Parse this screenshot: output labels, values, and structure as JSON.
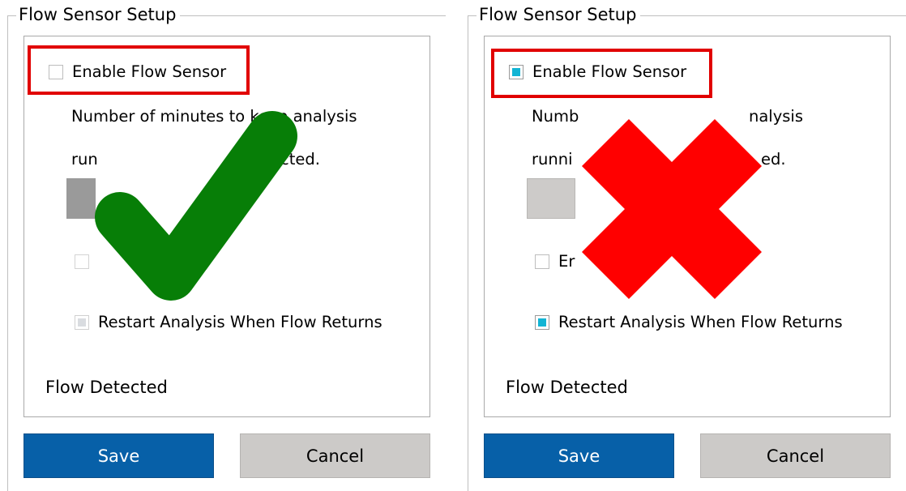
{
  "panels": [
    {
      "group_title": "Flow Sensor Setup",
      "enable_label": "Enable Flow Sensor",
      "enable_checked": false,
      "desc_line1": "Number of minutes to keep analysis",
      "desc_line2_visible_start": "run",
      "desc_line2_visible_end": "cted.",
      "second_checkbox_label_visible": "",
      "restart_label": "Restart Analysis When Flow Returns",
      "restart_checked": false,
      "status_text": "Flow Detected",
      "save_label": "Save",
      "cancel_label": "Cancel",
      "overlay_icon": "checkmark-icon"
    },
    {
      "group_title": "Flow Sensor Setup",
      "enable_label": "Enable Flow Sensor",
      "enable_checked": true,
      "desc_line1_visible_start": "Numb",
      "desc_line1_visible_end": "nalysis",
      "desc_line2_visible_start": "runni",
      "desc_line2_visible_end": "ed.",
      "second_checkbox_label_visible": "Er",
      "restart_label": "Restart Analysis When Flow Returns",
      "restart_checked": true,
      "status_text": "Flow Detected",
      "save_label": "Save",
      "cancel_label": "Cancel",
      "overlay_icon": "cross-icon"
    }
  ],
  "colors": {
    "accent_checkbox": "#12b4d4",
    "disabled_checkbox": "#d9dce0",
    "highlight_border": "#e10000",
    "save_button": "#0760a8",
    "cancel_button": "#cccac8",
    "check_green": "#077e07",
    "cross_red": "#ff0000"
  }
}
